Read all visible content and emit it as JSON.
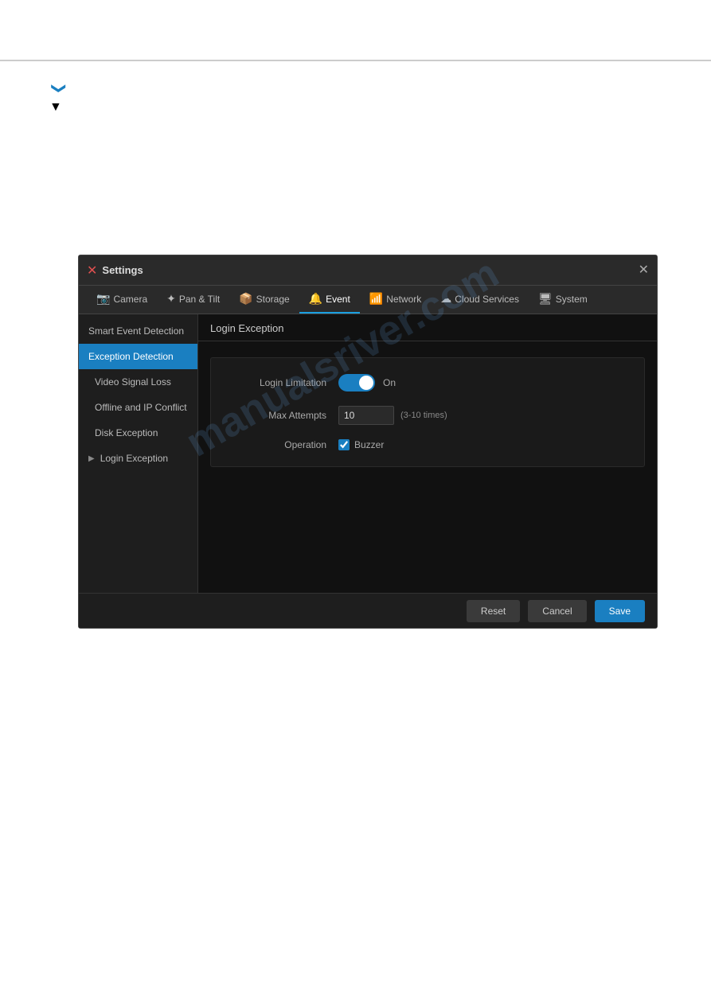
{
  "page": {
    "watermark": "manualsriver.com"
  },
  "chevron": {
    "icon": "chevron-down"
  },
  "dialog": {
    "title": "Settings",
    "close_label": "✕"
  },
  "nav_tabs": [
    {
      "id": "camera",
      "label": "Camera",
      "icon": "📷",
      "active": false
    },
    {
      "id": "pan-tilt",
      "label": "Pan & Tilt",
      "icon": "✦",
      "active": false
    },
    {
      "id": "storage",
      "label": "Storage",
      "icon": "📦",
      "active": false
    },
    {
      "id": "event",
      "label": "Event",
      "icon": "🔔",
      "active": true
    },
    {
      "id": "network",
      "label": "Network",
      "icon": "📶",
      "active": false
    },
    {
      "id": "cloud-services",
      "label": "Cloud Services",
      "icon": "☁",
      "active": false
    },
    {
      "id": "system",
      "label": "System",
      "icon": "🖥",
      "active": false
    }
  ],
  "sidebar": {
    "items": [
      {
        "id": "smart-event-detection",
        "label": "Smart Event Detection",
        "active": false,
        "indent": 0
      },
      {
        "id": "exception-detection",
        "label": "Exception Detection",
        "active": true,
        "indent": 0
      },
      {
        "id": "video-signal-loss",
        "label": "Video Signal Loss",
        "active": false,
        "indent": 1
      },
      {
        "id": "offline-ip-conflict",
        "label": "Offline and IP Conflict",
        "active": false,
        "indent": 1
      },
      {
        "id": "disk-exception",
        "label": "Disk Exception",
        "active": false,
        "indent": 1
      },
      {
        "id": "login-exception",
        "label": "Login Exception",
        "active": false,
        "indent": 0,
        "arrow": "▶"
      }
    ]
  },
  "panel": {
    "title": "Login Exception",
    "form": {
      "login_limitation_label": "Login Limitation",
      "login_limitation_value": true,
      "login_limitation_status": "On",
      "max_attempts_label": "Max Attempts",
      "max_attempts_value": "10",
      "max_attempts_hint": "(3-10 times)",
      "operation_label": "Operation",
      "buzzer_label": "Buzzer",
      "buzzer_checked": true
    }
  },
  "footer": {
    "reset_label": "Reset",
    "cancel_label": "Cancel",
    "save_label": "Save"
  }
}
